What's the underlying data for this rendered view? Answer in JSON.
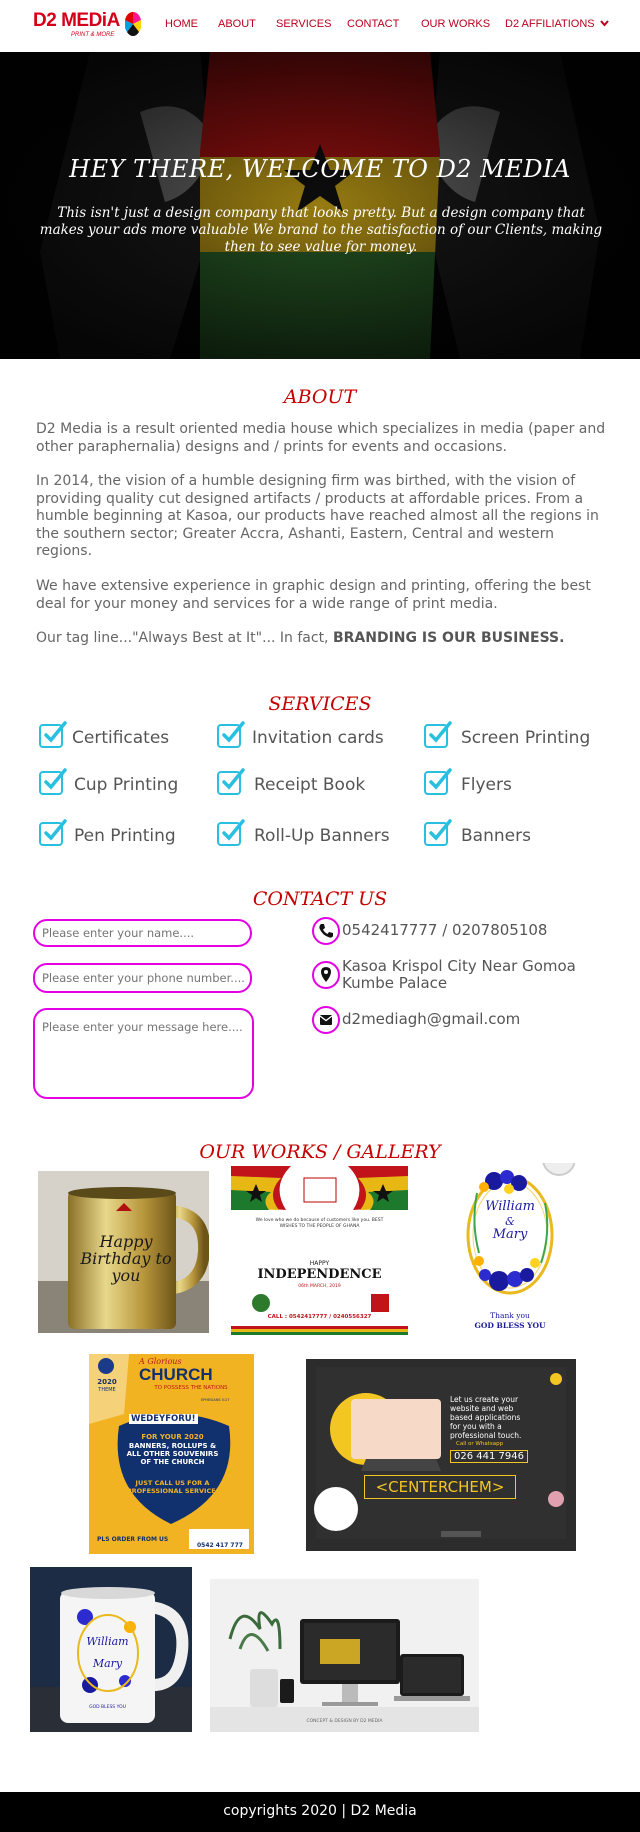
{
  "brand": {
    "name": "D2 MEDiA",
    "tagline": "PRINT & MORE"
  },
  "nav": {
    "home": "HOME",
    "about": "ABOUT",
    "services": "SERVICES",
    "contact": "CONTACT",
    "works": "OUR WORKS",
    "affiliations": "D2 AFFILIATIONS"
  },
  "hero": {
    "title": "HEY THERE, WELCOME TO D2 MEDIA",
    "subtitle": "This isn't just a design company that looks pretty. But a design company that makes your ads more valuable We brand to the satisfaction of our Clients, making then to see value for money."
  },
  "about": {
    "title": "ABOUT",
    "p1": "D2 Media is a result oriented media house which specializes in media (paper and other paraphernalia)  designs and / prints for events and occasions.",
    "p2": "In 2014, the vision of a humble designing firm was birthed,  with the vision of providing quality cut designed artifacts / products at affordable prices. From a humble beginning at Kasoa,  our products have reached almost all the regions in the southern sector; Greater Accra,  Ashanti,  Eastern,  Central and western regions.",
    "p3": "We have extensive experience in graphic design  and printing,  offering the best deal for your money and services for a wide range of print media.",
    "p4_prefix": "Our tag line...\"Always Best at It\"... In fact, ",
    "p4_bold": "BRANDING IS OUR BUSINESS."
  },
  "services": {
    "title": "SERVICES",
    "items": [
      "Certificates",
      "Invitation cards",
      "Screen Printing",
      "Cup Printing",
      "Receipt Book",
      "Flyers",
      "Pen Printing",
      "Roll-Up Banners",
      "Banners"
    ]
  },
  "contact": {
    "title": "CONTACT US",
    "name_placeholder": "Please enter your name....",
    "phone_placeholder": "Please enter your phone number....",
    "message_placeholder": "Please enter your message here....",
    "phone": "0542417777 / 0207805108",
    "address": "Kasoa Krispol City Near Gomoa Kumbe Palace",
    "email": "d2mediagh@gmail.com"
  },
  "gallery": {
    "title": "OUR WORKS / GALLERY",
    "mug1_text": "Happy Birthday to you",
    "indep": {
      "title": "INDEPENDENCE",
      "happy": "HAPPY",
      "tagline": "We love who we do because of customers like you. BEST WISHES TO THE PEOPLE OF GHANA",
      "date": "06th MARCH, 2019",
      "call": "CALL : 0542417777 / 0240556327"
    },
    "wedding": {
      "name1": "William",
      "amp": "&",
      "name2": "Mary",
      "thanks1": "Thank you",
      "thanks2": "GOD BLESS YOU"
    },
    "church": {
      "year": "2020",
      "theme": "THEME",
      "title1": "A Glorious",
      "title2": "CHURCH",
      "title3": "TO POSSESS THE NATIONS",
      "ref": "EPHESIANS 5:27",
      "body1": "WEDEYFORU!",
      "body2": "FOR YOUR 2020",
      "body3": "BANNERS, ROLLUPS & ALL OTHER SOUVENIRS OF THE CHURCH",
      "body4": "JUST CALL US FOR A PROFESSIONAL SERVICE.",
      "order": "PLS ORDER FROM US",
      "phone": "0542 417 777"
    },
    "centerchem": {
      "text": "Let us create your website and web based applications for you with a professional touch.",
      "call": "Call or Whatsapp",
      "phone": "026 441 7946",
      "brand": "<CENTERCHEM>"
    },
    "mug2": {
      "name1": "William",
      "name2": "Mary",
      "footer": "GOD BLESS YOU"
    },
    "laptop": {
      "caption": "CONCEPT & DESIGN BY D2 MEDIA"
    }
  },
  "footer": {
    "text": "copyrights 2020 | D2 Media"
  },
  "colors": {
    "accent_red": "#c40000",
    "nav_red": "#b8001c",
    "magenta": "#e400e4",
    "check_cyan": "#29bfe0"
  }
}
